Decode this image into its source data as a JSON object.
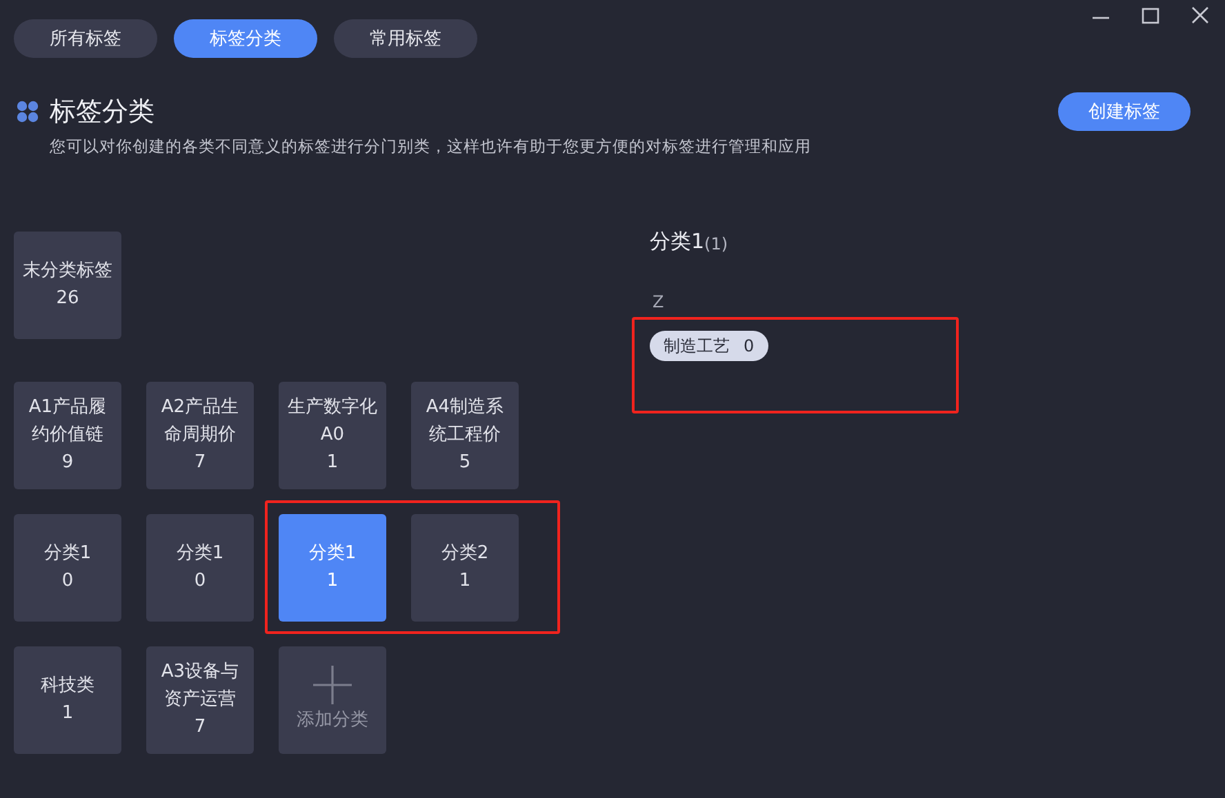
{
  "tabs": [
    {
      "label": "所有标签",
      "selected": false
    },
    {
      "label": "标签分类",
      "selected": true
    },
    {
      "label": "常用标签",
      "selected": false
    }
  ],
  "header": {
    "title": "标签分类",
    "description": "您可以对你创建的各类不同意义的标签进行分门别类，这样也许有助于您更方便的对标签进行管理和应用",
    "create_button": "创建标签"
  },
  "tile_groups": [
    [
      {
        "kind": "category",
        "name": "末分类标签",
        "count": "26",
        "selected": false
      }
    ],
    [
      {
        "kind": "category",
        "name": "A1产品履约价值链",
        "count": "9",
        "selected": false
      },
      {
        "kind": "category",
        "name": "A2产品生命周期价",
        "count": "7",
        "selected": false
      },
      {
        "kind": "category",
        "name": "生产数字化A0",
        "count": "1",
        "selected": false
      },
      {
        "kind": "category",
        "name": "A4制造系统工程价",
        "count": "5",
        "selected": false
      },
      {
        "kind": "category",
        "name": "分类1",
        "count": "0",
        "selected": false
      },
      {
        "kind": "category",
        "name": "分类1",
        "count": "0",
        "selected": false
      },
      {
        "kind": "category",
        "name": "分类1",
        "count": "1",
        "selected": true
      },
      {
        "kind": "category",
        "name": "分类2",
        "count": "1",
        "selected": false
      },
      {
        "kind": "category",
        "name": "科技类",
        "count": "1",
        "selected": false
      },
      {
        "kind": "category",
        "name": "A3设备与资产运营",
        "count": "7",
        "selected": false
      },
      {
        "kind": "add",
        "name": "添加分类"
      }
    ]
  ],
  "detail": {
    "title": "分类1",
    "count": "(1)",
    "sections": [
      {
        "letter": "Z",
        "tags": [
          {
            "name": "制造工艺",
            "count": "0"
          }
        ]
      }
    ]
  }
}
